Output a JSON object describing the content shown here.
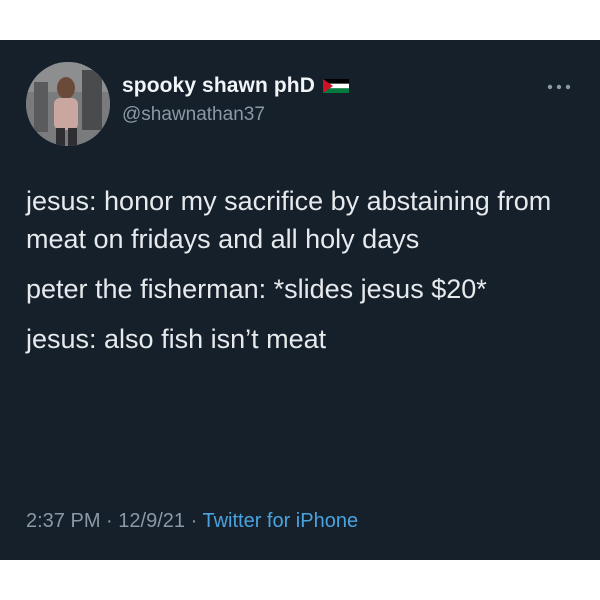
{
  "tweet": {
    "author": {
      "display_name": "spooky shawn phD",
      "handle": "@shawnathan37",
      "flag_icon": "palestine-flag-icon",
      "flag_colors": [
        "#000000",
        "#ffffff",
        "#007a3d",
        "#ce1126"
      ]
    },
    "more_icon": "more-horizontal-icon",
    "lines": [
      "jesus: honor my sacrifice by abstaining from meat on fridays and all holy days",
      "peter the fisherman: *slides jesus $20*",
      "jesus: also fish isn’t meat"
    ],
    "time": "2:37 PM",
    "date": "12/9/21",
    "separator": "·",
    "source": "Twitter for iPhone"
  },
  "colors": {
    "background": "#15202b",
    "text": "#e7eaec",
    "muted": "#8b98a5",
    "link": "#4aa3df"
  }
}
